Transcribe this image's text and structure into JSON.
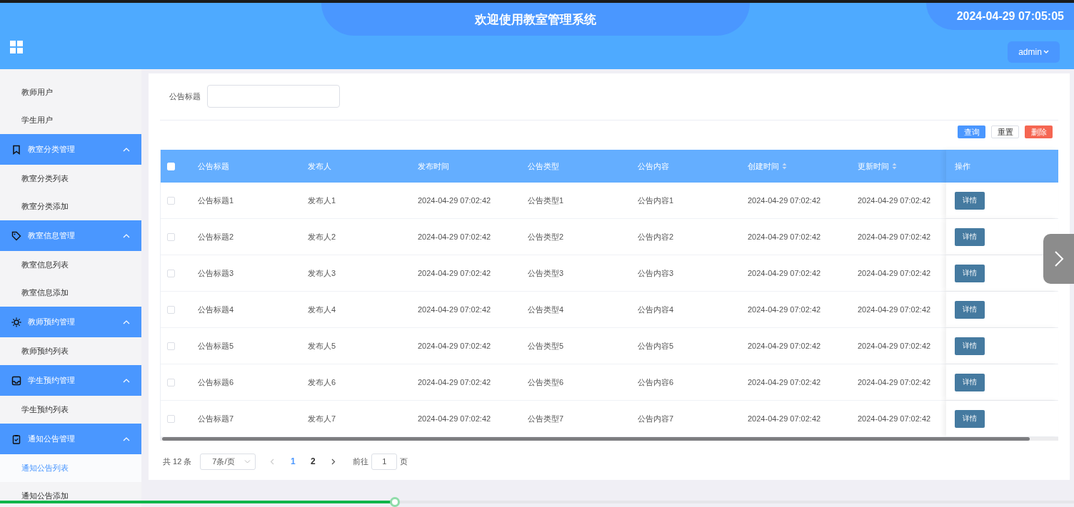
{
  "header": {
    "title": "欢迎使用教室管理系统",
    "clock": "2024-04-29 07:05:05",
    "user_menu": "admin"
  },
  "sidebar": {
    "items": [
      {
        "label": "教师用户",
        "selected": false
      },
      {
        "label": "学生用户",
        "selected": false
      }
    ],
    "groups": [
      {
        "label": "教室分类管理",
        "expanded": true,
        "children": [
          {
            "label": "教室分类列表",
            "selected": false
          },
          {
            "label": "教室分类添加",
            "selected": false
          }
        ]
      },
      {
        "label": "教室信息管理",
        "expanded": true,
        "children": [
          {
            "label": "教室信息列表",
            "selected": false
          },
          {
            "label": "教室信息添加",
            "selected": false
          }
        ]
      },
      {
        "label": "教师预约管理",
        "expanded": true,
        "children": [
          {
            "label": "教师预约列表",
            "selected": false
          }
        ]
      },
      {
        "label": "学生预约管理",
        "expanded": true,
        "children": [
          {
            "label": "学生预约列表",
            "selected": false
          }
        ]
      },
      {
        "label": "通知公告管理",
        "expanded": true,
        "children": [
          {
            "label": "通知公告列表",
            "selected": true
          },
          {
            "label": "通知公告添加",
            "selected": false
          }
        ]
      }
    ]
  },
  "search": {
    "label": "公告标题"
  },
  "actions": [
    {
      "label": "查询",
      "kind": "primary"
    },
    {
      "label": "重置",
      "kind": "plain"
    },
    {
      "label": "删除",
      "kind": "danger"
    }
  ],
  "table": {
    "all_selected": false,
    "columns": [
      {
        "label": "公告标题",
        "sortable": false
      },
      {
        "label": "发布人",
        "sortable": false
      },
      {
        "label": "发布时间",
        "sortable": false
      },
      {
        "label": "公告类型",
        "sortable": false
      },
      {
        "label": "公告内容",
        "sortable": false
      },
      {
        "label": "创建时间",
        "sortable": true
      },
      {
        "label": "更新时间",
        "sortable": true
      },
      {
        "label": "操作",
        "sortable": false
      }
    ],
    "rows": [
      {
        "selected": false,
        "cells": [
          "公告标题1",
          "发布人1",
          "2024-04-29 07:02:42",
          "公告类型1",
          "公告内容1",
          "2024-04-29 07:02:42",
          "2024-04-29 07:02:42"
        ],
        "action": "详情"
      },
      {
        "selected": false,
        "cells": [
          "公告标题2",
          "发布人2",
          "2024-04-29 07:02:42",
          "公告类型2",
          "公告内容2",
          "2024-04-29 07:02:42",
          "2024-04-29 07:02:42"
        ],
        "action": "详情"
      },
      {
        "selected": false,
        "cells": [
          "公告标题3",
          "发布人3",
          "2024-04-29 07:02:42",
          "公告类型3",
          "公告内容3",
          "2024-04-29 07:02:42",
          "2024-04-29 07:02:42"
        ],
        "action": "详情"
      },
      {
        "selected": false,
        "cells": [
          "公告标题4",
          "发布人4",
          "2024-04-29 07:02:42",
          "公告类型4",
          "公告内容4",
          "2024-04-29 07:02:42",
          "2024-04-29 07:02:42"
        ],
        "action": "详情"
      },
      {
        "selected": false,
        "cells": [
          "公告标题5",
          "发布人5",
          "2024-04-29 07:02:42",
          "公告类型5",
          "公告内容5",
          "2024-04-29 07:02:42",
          "2024-04-29 07:02:42"
        ],
        "action": "详情"
      },
      {
        "selected": false,
        "cells": [
          "公告标题6",
          "发布人6",
          "2024-04-29 07:02:42",
          "公告类型6",
          "公告内容6",
          "2024-04-29 07:02:42",
          "2024-04-29 07:02:42"
        ],
        "action": "详情"
      },
      {
        "selected": false,
        "cells": [
          "公告标题7",
          "发布人7",
          "2024-04-29 07:02:42",
          "公告类型7",
          "公告内容7",
          "2024-04-29 07:02:42",
          "2024-04-29 07:02:42"
        ],
        "action": "详情"
      }
    ]
  },
  "pagination": {
    "total": "共 12 条",
    "page_size": "7条/页",
    "pages": [
      {
        "label": "1",
        "selected": true
      },
      {
        "label": "2",
        "selected": false
      }
    ],
    "goto_label": "前往",
    "goto_value": "1",
    "goto_suffix": "页"
  },
  "progress": {
    "level": 0.368
  }
}
